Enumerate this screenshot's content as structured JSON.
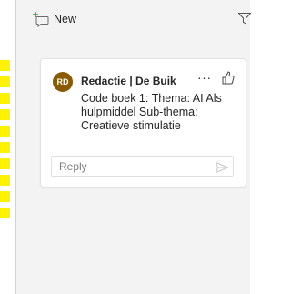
{
  "toolbar": {
    "new_label": "New",
    "new_icon": "new-comment-icon",
    "filter_icon": "filter-icon"
  },
  "comment": {
    "avatar_initials": "RD",
    "avatar_color": "#8a5a00",
    "author": "Redactie | De Buik",
    "more_label": "···",
    "like_icon": "thumbs-up-icon",
    "text": "Code boek 1: Thema: AI Als hulpmiddel Sub-thema: Creatieve stimulatie",
    "reply_placeholder": "Reply",
    "send_icon": "send-icon"
  },
  "colors": {
    "highlight": "#fff200",
    "pane_background": "#f3f3f3",
    "new_icon_accent": "#2e9c3a"
  }
}
